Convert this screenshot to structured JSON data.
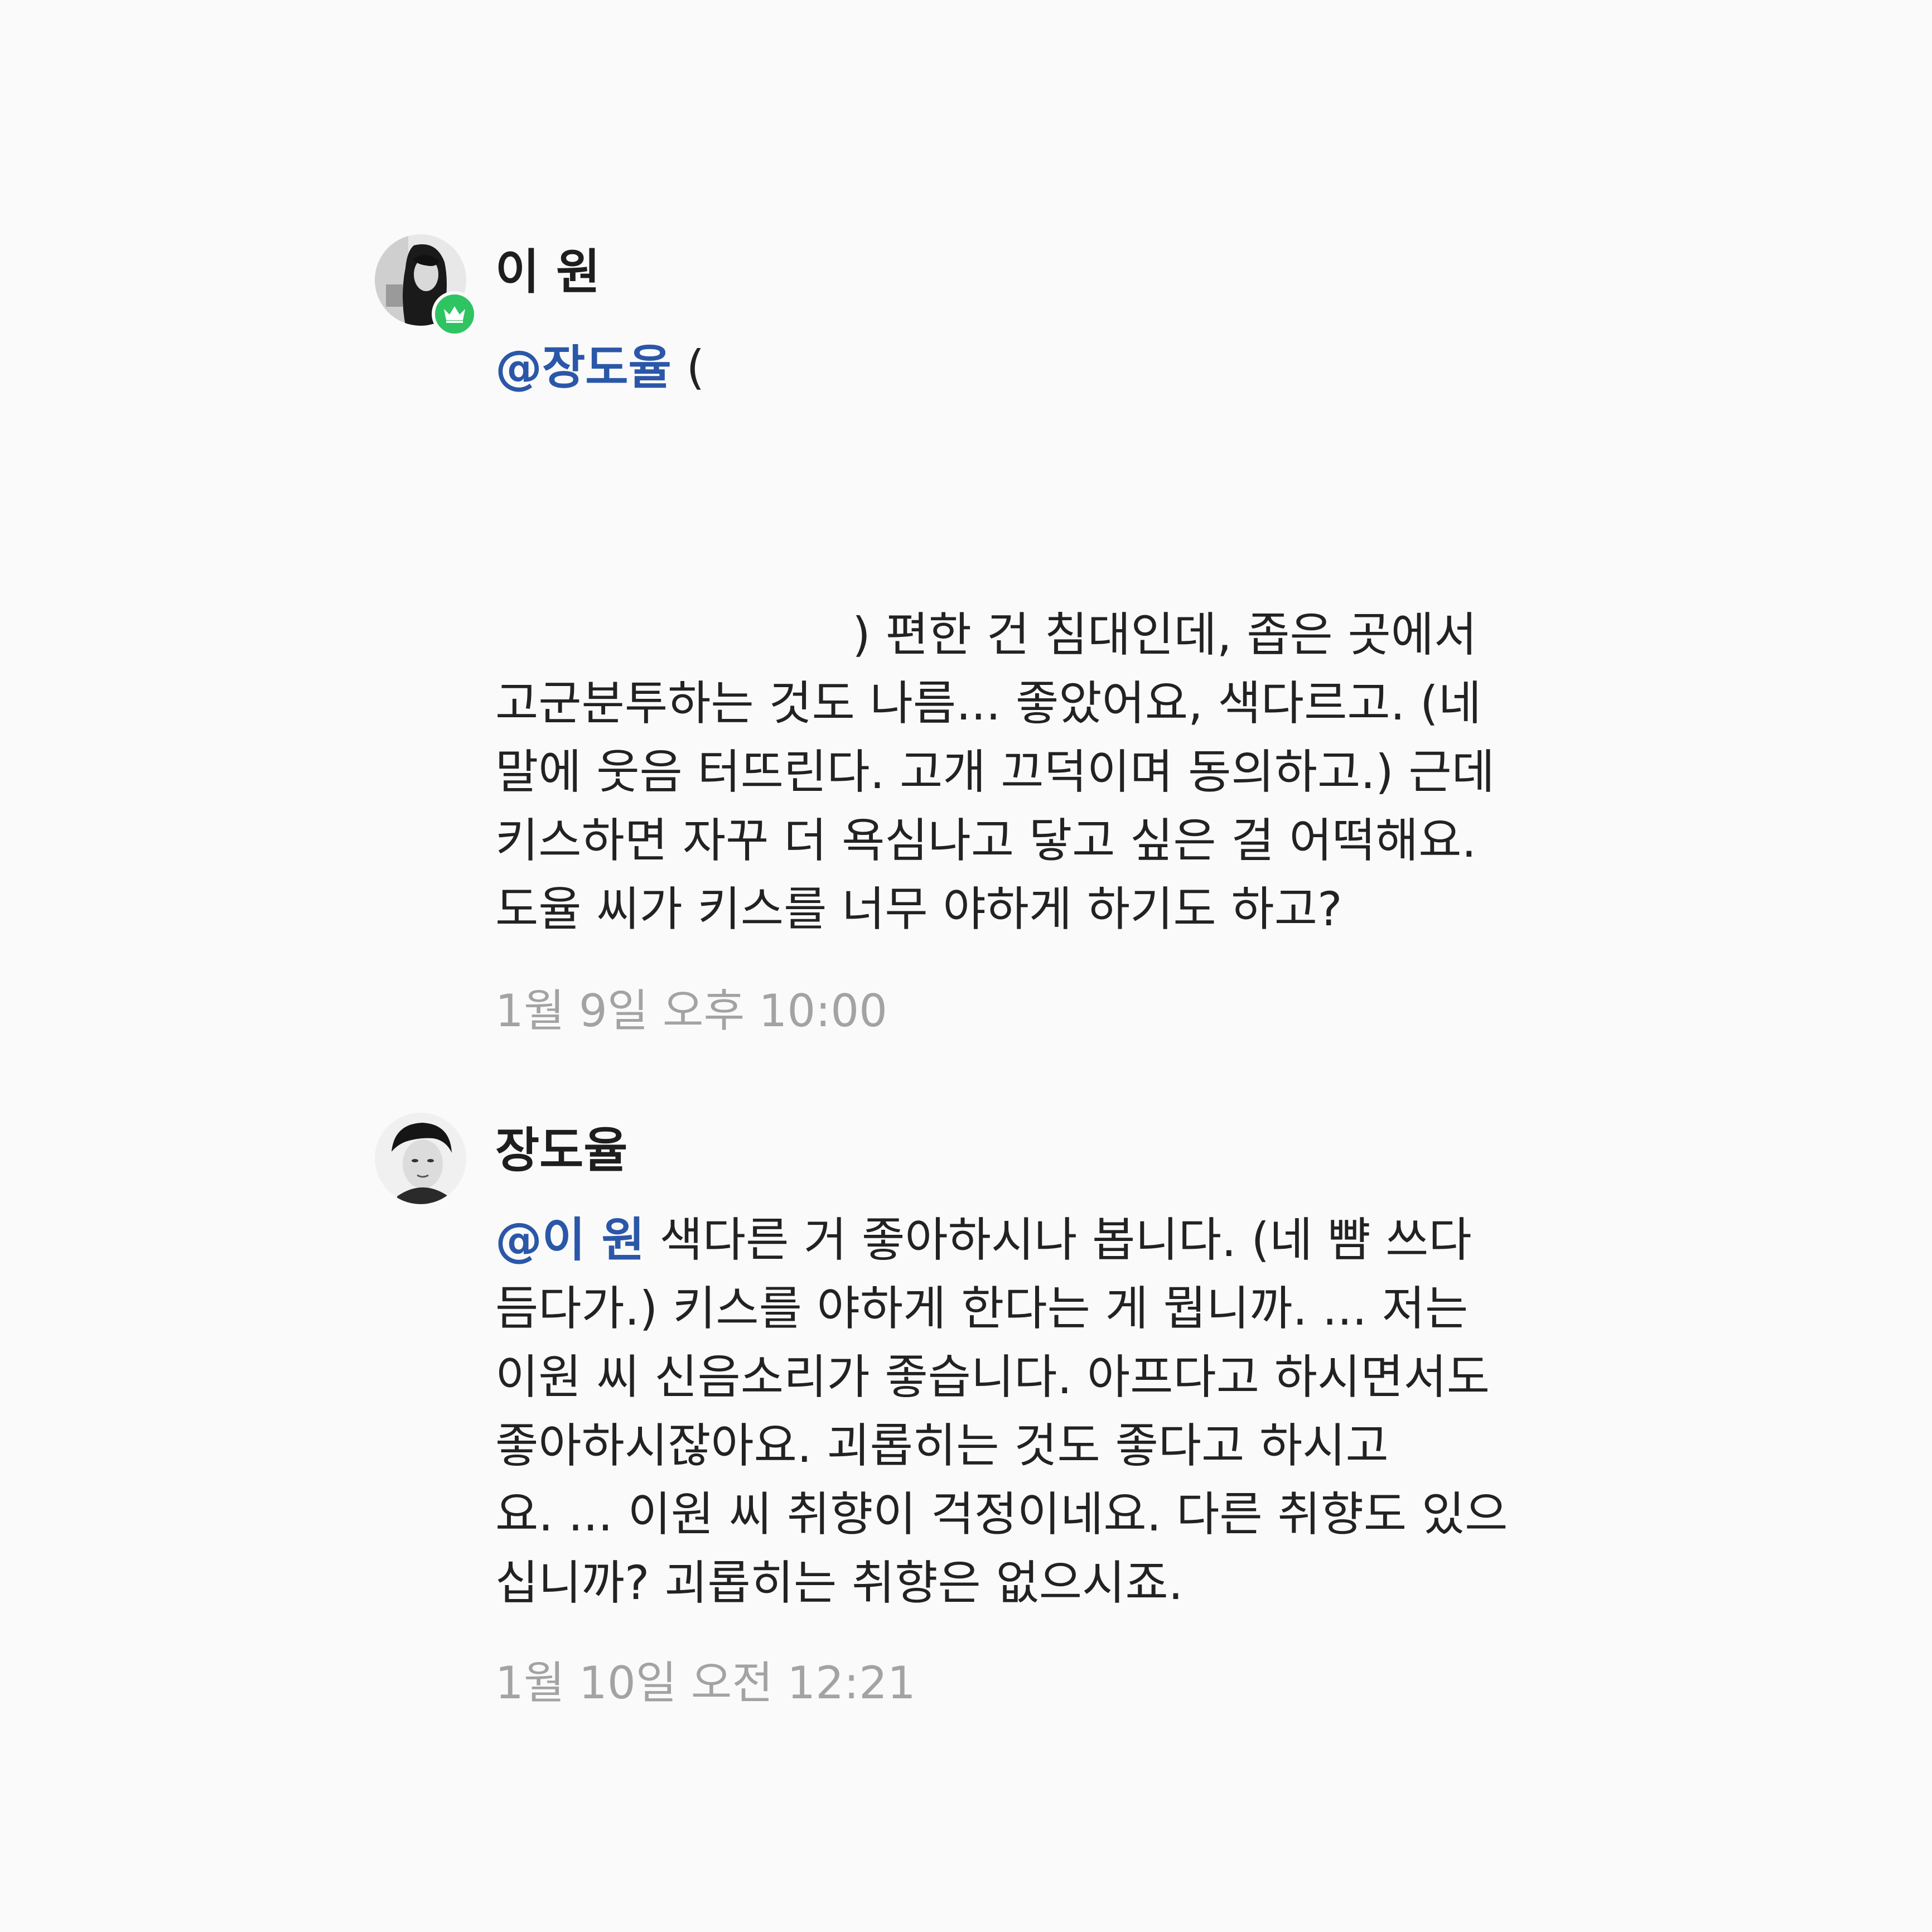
{
  "messages": [
    {
      "sender": "이 원",
      "avatar_icon": "profile-photo-woman",
      "badge_icon": "crown-icon",
      "badge_color": "#2ec461",
      "mention": "@장도율",
      "first_line_rest": " (",
      "lines": [
        ") 편한 건 침대인데, 좁은 곳에서",
        "고군분투하는 것도 나름... 좋았어요, 색다르고. (네",
        "말에 웃음 터뜨린다. 고개 끄덕이며 동의하고.) 근데",
        "키스하면 자꾸 더 욕심나고 닿고 싶은 걸 어떡해요.",
        "도율 씨가 키스를 너무 야하게 하기도 하고?"
      ],
      "timestamp": "1월 9일 오후 10:00"
    },
    {
      "sender": "장도율",
      "avatar_icon": "profile-photo-man",
      "mention": "@이 원",
      "first_line_rest": " 색다른 거 좋아하시나 봅니다. (네 뺨 쓰다",
      "lines": [
        "듬다가.) 키스를 야하게 한다는 게 뭡니까. ... 저는",
        "이원 씨 신음소리가 좋습니다. 아프다고 하시면서도",
        "좋아하시잖아요. 괴롭히는 것도 좋다고 하시고",
        "요. ... 이원 씨 취향이 걱정이네요. 다른 취향도 있으",
        "십니까? 괴롭히는 취향은 없으시죠."
      ],
      "timestamp": "1월 10일 오전 12:21"
    }
  ],
  "colors": {
    "background": "#fafafa",
    "mention": "#2b57a8",
    "timestamp": "#a3a3a3",
    "text": "#222222"
  }
}
